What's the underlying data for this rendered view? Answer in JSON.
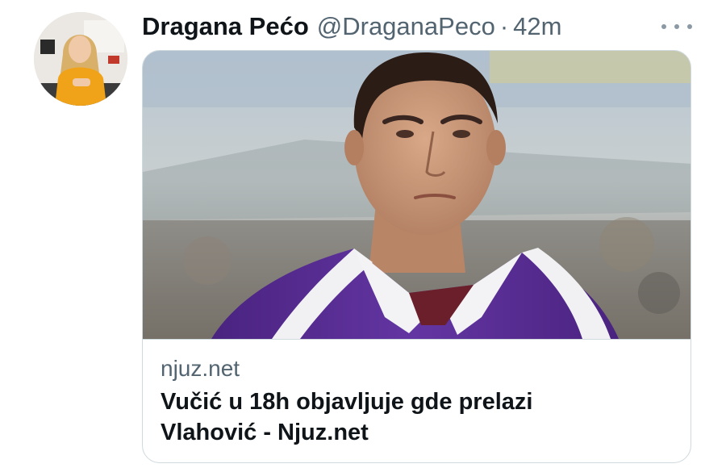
{
  "tweet": {
    "author": {
      "display_name": "Dragana Pećo",
      "handle": "@DraganaPeco",
      "avatar_icon": "profile-photo"
    },
    "separator": "·",
    "time": "42m",
    "more_icon": "more-dots-icon"
  },
  "card": {
    "domain": "njuz.net",
    "title": "Vučić u 18h objavljuje gde prelazi Vlahović - Njuz.net"
  },
  "colors": {
    "text_primary": "#0f1419",
    "text_secondary": "#536471",
    "border": "#cfd9de",
    "jersey_purple": "#5b2c94"
  }
}
